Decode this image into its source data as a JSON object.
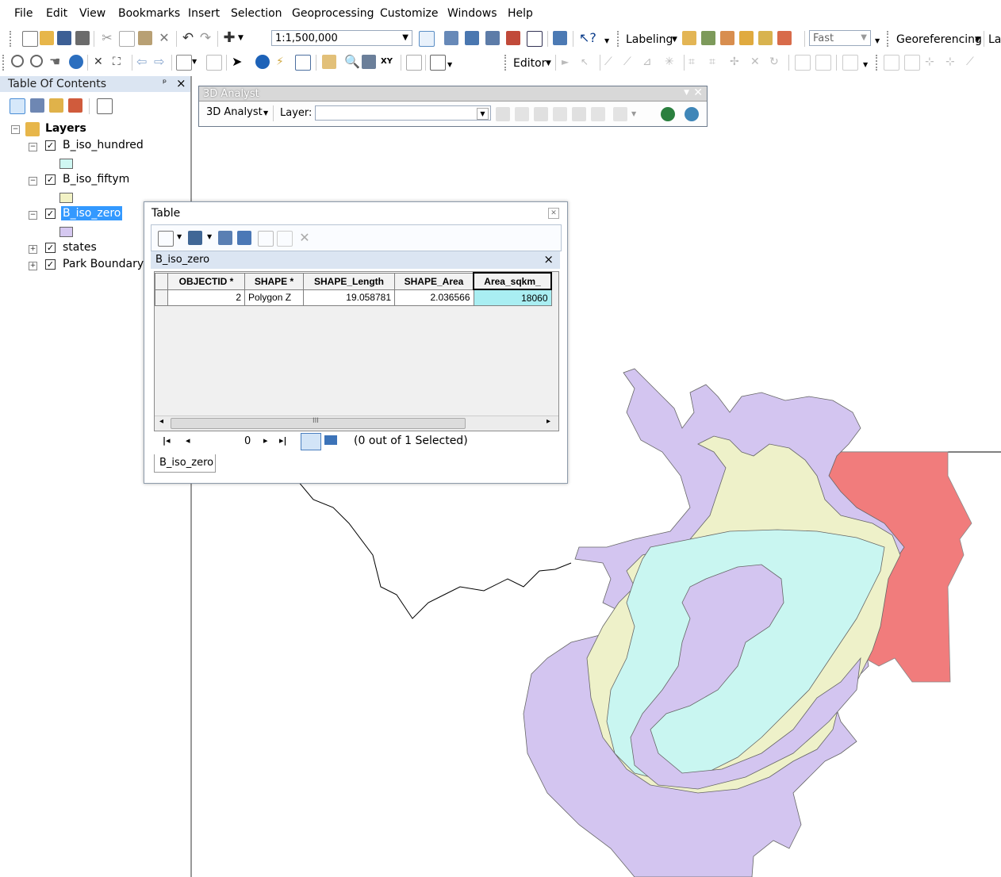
{
  "menu": [
    "File",
    "Edit",
    "View",
    "Bookmarks",
    "Insert",
    "Selection",
    "Geoprocessing",
    "Customize",
    "Windows",
    "Help"
  ],
  "standard_toolbar": {
    "scale": "1:1,500,000",
    "labeling_label": "Labeling",
    "fast_label": "Fast",
    "georeferencing_label": "Georeferencing",
    "la_label": "La"
  },
  "tools_toolbar": {
    "editor_label": "Editor"
  },
  "toc": {
    "title": "Table Of Contents",
    "pin": "ᵖ",
    "close": "×",
    "root": "Layers",
    "layers": [
      {
        "name": "B_iso_hundred",
        "color": "#cff7f2",
        "checked": true
      },
      {
        "name": "B_iso_fiftym",
        "color": "#f2f2c5",
        "checked": true
      },
      {
        "name": "B_iso_zero",
        "color": "#d5c8f0",
        "checked": true
      },
      {
        "name": "states",
        "checked": true
      },
      {
        "name": "Park Boundary",
        "checked": true
      }
    ]
  },
  "analyst_window": {
    "title": "3D Analyst",
    "menu_label": "3D Analyst",
    "layer_label": "Layer:",
    "layer_value": ""
  },
  "table_window": {
    "title": "Table",
    "layer_tab_header": "B_iso_zero",
    "columns": [
      "OBJECTID *",
      "SHAPE *",
      "SHAPE_Length",
      "SHAPE_Area",
      "Area_sqkm_"
    ],
    "rows": [
      [
        "2",
        "Polygon Z",
        "19.058781",
        "2.036566",
        "18060"
      ]
    ],
    "scroll_marker": "III",
    "record_number": "0",
    "selection_status": "(0 out of 1 Selected)",
    "bottom_tab": "B_iso_zero"
  },
  "colors": {
    "purple": "#d3c5f0",
    "yellow": "#eef1c9",
    "cyan": "#c9f6f1",
    "red": "#f17c7c",
    "selection_blue": "#3399ff",
    "highlight_cell": "#a9eef2"
  }
}
